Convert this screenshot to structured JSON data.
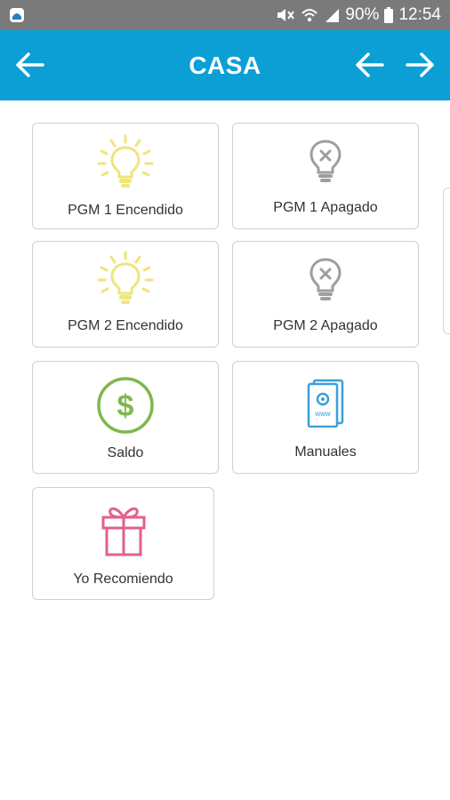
{
  "status_bar": {
    "battery_percent": "90%",
    "time": "12:54",
    "icons": [
      "app-notification-icon",
      "mute-icon",
      "wifi-icon",
      "signal-icon",
      "battery-icon"
    ]
  },
  "app_bar": {
    "title": "CASA",
    "background_color": "#0b9fd6",
    "left_icon": "arrow-left-icon",
    "right_icons": [
      "arrow-left-icon",
      "arrow-right-icon"
    ]
  },
  "tiles": [
    {
      "label": "PGM 1 Encendido",
      "icon": "lightbulb-on-icon",
      "icon_color": "#efe67a"
    },
    {
      "label": "PGM 1 Apagado",
      "icon": "lightbulb-off-icon",
      "icon_color": "#9e9e9e"
    },
    {
      "label": "PGM 2 Encendido",
      "icon": "lightbulb-on-icon",
      "icon_color": "#efe67a"
    },
    {
      "label": "PGM 2 Apagado",
      "icon": "lightbulb-off-icon",
      "icon_color": "#9e9e9e"
    },
    {
      "label": "Saldo",
      "icon": "dollar-icon",
      "icon_color": "#7fb84e"
    },
    {
      "label": "Manuales",
      "icon": "manual-book-icon",
      "icon_color": "#3a9fd9",
      "icon_text": "www"
    },
    {
      "label": "Yo Recomiendo",
      "icon": "gift-icon",
      "icon_color": "#e2628a"
    }
  ]
}
